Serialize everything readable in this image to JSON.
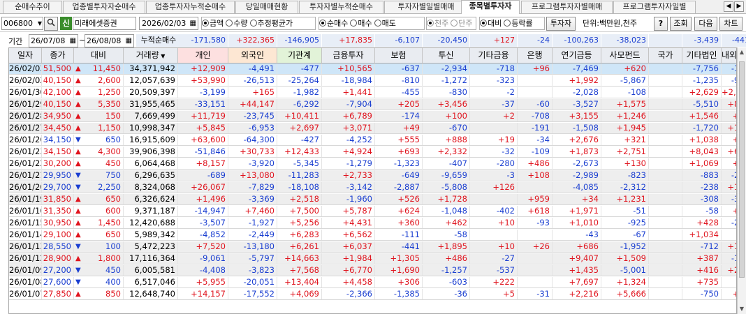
{
  "tabs": [
    "순매수추이",
    "업종별투자자순매수",
    "업종투자자누적순매수",
    "당일매매현황",
    "투자자별누적순매수",
    "투자자별일별매매",
    "종목별투자자",
    "프로그램투자자별매매",
    "프로그램투자자일별"
  ],
  "active_tab": 6,
  "tab_nav": {
    "prev": "◀",
    "next": "▶"
  },
  "toolbar": {
    "stock_code": "006800",
    "search_icon": "🔍",
    "credit_badge": "신",
    "stock_name": "미래에셋증권",
    "date": "2026/02/03",
    "amount_options": [
      "금액",
      "수량",
      "추정평균가"
    ],
    "amount_selected": 0,
    "buy_options": [
      "순매수",
      "매수",
      "매도"
    ],
    "buy_selected": 0,
    "unit_options": [
      "천주",
      "단주"
    ],
    "unit_selected": 0,
    "compare_options": [
      "대비",
      "등락률"
    ],
    "compare_selected": 0,
    "investor_button": "투자자",
    "unit_label": "단위:백만원,천주",
    "help_button": "?",
    "search_button": "조회",
    "next_button": "다음",
    "chart_button": "차트"
  },
  "period": {
    "label": "기간",
    "from": "26/07/08",
    "tilde": "~",
    "to": "26/08/08",
    "cumulative_label": "누적순매수"
  },
  "totals": {
    "individual": "-171,580",
    "foreign": "+322,365",
    "institution": "-146,905",
    "financial": "+17,835",
    "insurance": "-6,107",
    "trust": "-20,450",
    "other_finance": "+127",
    "bank": "-24",
    "pension": "-100,263",
    "private_fund": "-38,023",
    "nation": "",
    "other_corp": "-3,439",
    "domestic_foreign": "-441"
  },
  "columns": [
    "일자",
    "종가",
    "대비",
    "거래량",
    "개인",
    "외국인",
    "기관계",
    "금융투자",
    "보험",
    "투신",
    "기타금융",
    "은행",
    "연기금등",
    "사모펀드",
    "국가",
    "기타법인",
    "내외국인"
  ],
  "rows": [
    [
      "26/02/03",
      "51,500",
      "11,450",
      "34,371,942",
      "+12,909",
      "-4,491",
      "-477",
      "+10,565",
      "-637",
      "-2,934",
      "-718",
      "+96",
      "-7,469",
      "+620",
      "",
      "-7,756",
      "-185"
    ],
    [
      "26/02/02",
      "40,150",
      "2,600",
      "12,057,639",
      "+53,990",
      "-26,513",
      "-25,264",
      "-18,984",
      "-810",
      "-1,272",
      "-323",
      "",
      "+1,992",
      "-5,867",
      "",
      "-1,235",
      "-979"
    ],
    [
      "26/01/30",
      "42,100",
      "1,250",
      "20,509,397",
      "-3,199",
      "+165",
      "-1,982",
      "+1,441",
      "-455",
      "-830",
      "-2",
      "",
      "-2,028",
      "-108",
      "",
      "+2,629",
      "+2,387"
    ],
    [
      "26/01/29",
      "40,150",
      "5,350",
      "31,955,465",
      "-33,151",
      "+44,147",
      "-6,292",
      "-7,904",
      "+205",
      "+3,456",
      "-37",
      "-60",
      "-3,527",
      "+1,575",
      "",
      "-5,510",
      "+807"
    ],
    [
      "26/01/28",
      "34,950",
      "150",
      "7,669,499",
      "+11,719",
      "-23,745",
      "+10,411",
      "+6,789",
      "-174",
      "+100",
      "+2",
      "-708",
      "+3,155",
      "+1,246",
      "",
      "+1,546",
      "+68"
    ],
    [
      "26/01/27",
      "34,450",
      "1,150",
      "10,998,347",
      "+5,845",
      "-6,953",
      "+2,697",
      "+3,071",
      "+49",
      "-670",
      "",
      "-191",
      "-1,508",
      "+1,945",
      "",
      "-1,720",
      "+131"
    ],
    [
      "26/01/26",
      "34,150",
      "650",
      "16,915,609",
      "+63,600",
      "-64,300",
      "-427",
      "-4,252",
      "+555",
      "+888",
      "+19",
      "-34",
      "+2,676",
      "+321",
      "",
      "+1,038",
      "+89"
    ],
    [
      "26/01/23",
      "34,150",
      "4,300",
      "39,906,398",
      "-51,846",
      "+30,733",
      "+12,433",
      "+4,924",
      "+693",
      "+2,332",
      "-32",
      "-109",
      "+1,873",
      "+2,751",
      "",
      "+8,043",
      "+636"
    ],
    [
      "26/01/22",
      "30,200",
      "450",
      "6,064,468",
      "+8,157",
      "-3,920",
      "-5,345",
      "-1,279",
      "-1,323",
      "-407",
      "-280",
      "+486",
      "-2,673",
      "+130",
      "",
      "+1,069",
      "+39"
    ],
    [
      "26/01/21",
      "29,950",
      "750",
      "6,296,635",
      "-689",
      "+13,080",
      "-11,283",
      "+2,733",
      "-649",
      "-9,659",
      "-3",
      "+108",
      "-2,989",
      "-823",
      "",
      "-883",
      "-226"
    ],
    [
      "26/01/20",
      "29,700",
      "2,250",
      "8,324,068",
      "+26,067",
      "-7,829",
      "-18,108",
      "-3,142",
      "-2,887",
      "-5,808",
      "+126",
      "",
      "-4,085",
      "-2,312",
      "",
      "-238",
      "+109"
    ],
    [
      "26/01/19",
      "31,850",
      "650",
      "6,326,624",
      "+1,496",
      "-3,369",
      "+2,518",
      "-1,960",
      "+526",
      "+1,728",
      "",
      "+959",
      "+34",
      "+1,231",
      "",
      "-308",
      "-307"
    ],
    [
      "26/01/16",
      "31,350",
      "600",
      "9,371,187",
      "-14,947",
      "+7,460",
      "+7,500",
      "+5,787",
      "+624",
      "-1,048",
      "-402",
      "+618",
      "+1,971",
      "-51",
      "",
      "-58",
      "+45"
    ],
    [
      "26/01/15",
      "30,950",
      "1,450",
      "12,420,688",
      "-3,507",
      "-1,927",
      "+5,256",
      "+4,431",
      "+360",
      "+462",
      "+10",
      "-93",
      "+1,010",
      "-925",
      "",
      "+428",
      "-249"
    ],
    [
      "26/01/14",
      "29,100",
      "650",
      "5,989,342",
      "-4,852",
      "-2,449",
      "+6,283",
      "+6,562",
      "-111",
      "-58",
      "",
      "",
      "-43",
      "-67",
      "",
      "+1,034",
      "-17"
    ],
    [
      "26/01/13",
      "28,550",
      "100",
      "5,472,223",
      "+7,520",
      "-13,180",
      "+6,261",
      "+6,037",
      "-441",
      "+1,895",
      "+10",
      "+26",
      "+686",
      "-1,952",
      "",
      "-712",
      "+111"
    ],
    [
      "26/01/12",
      "28,900",
      "1,800",
      "17,116,364",
      "-9,061",
      "-5,797",
      "+14,663",
      "+1,984",
      "+1,305",
      "+486",
      "-27",
      "",
      "+9,407",
      "+1,509",
      "",
      "+387",
      "-192"
    ],
    [
      "26/01/09",
      "27,200",
      "450",
      "6,005,581",
      "-4,408",
      "-3,823",
      "+7,568",
      "+6,770",
      "+1,690",
      "-1,257",
      "-537",
      "",
      "+1,435",
      "-5,001",
      "",
      "+416",
      "+247"
    ],
    [
      "26/01/08",
      "27,600",
      "400",
      "6,517,046",
      "+5,955",
      "-20,051",
      "+13,404",
      "+4,458",
      "+306",
      "-603",
      "+222",
      "",
      "+7,697",
      "+1,324",
      "",
      "+735",
      "-43"
    ],
    [
      "26/01/07",
      "27,850",
      "850",
      "12,648,740",
      "+14,157",
      "-17,552",
      "+4,069",
      "-2,366",
      "-1,385",
      "-36",
      "+5",
      "-31",
      "+2,216",
      "+5,666",
      "",
      "-750",
      "+77"
    ]
  ],
  "row_price_color": [
    "red",
    "red",
    "red",
    "red",
    "red",
    "red",
    "blue",
    "red",
    "red",
    "blue",
    "blue",
    "red",
    "red",
    "red",
    "red",
    "blue",
    "red",
    "blue",
    "blue",
    "red"
  ],
  "row_change_dir": [
    "up",
    "up",
    "up",
    "up",
    "up",
    "up",
    "down",
    "up",
    "up",
    "down",
    "down",
    "up",
    "up",
    "up",
    "up",
    "down",
    "up",
    "down",
    "down",
    "up"
  ],
  "colors": {
    "up": "#e0141e",
    "down": "#1b3fd1",
    "selected_row": "#cfe6f8",
    "header_bg": "#e9ecf1",
    "col_foreign_bg": "#fde7d3",
    "col_inst_bg": "#e2f3d8",
    "col_indiv_bg": "#fde0e0"
  }
}
